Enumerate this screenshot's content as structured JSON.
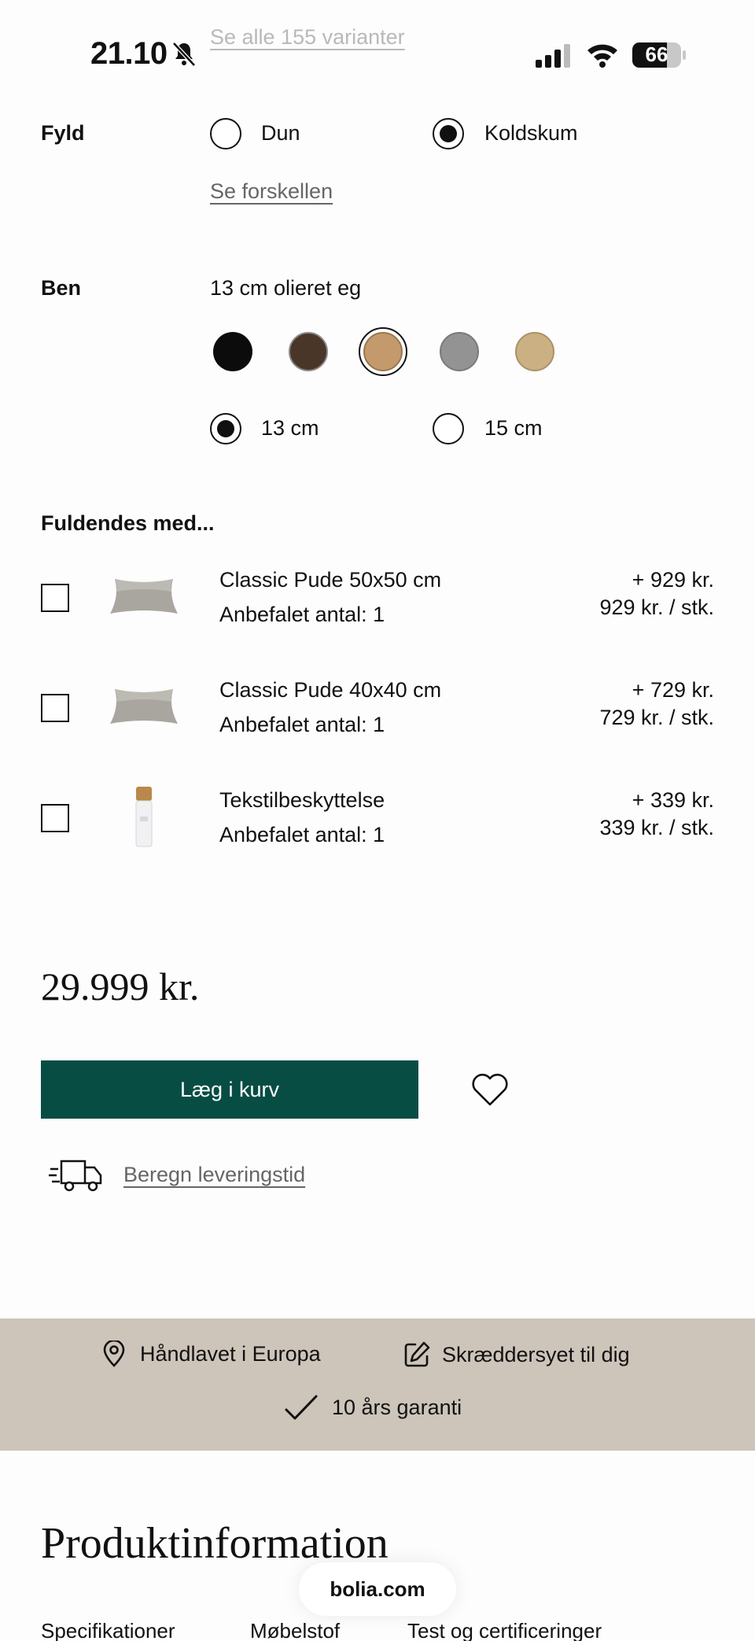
{
  "status_bar": {
    "time": "21.10",
    "battery": "66"
  },
  "variants_link": "Se alle 155 varianter",
  "fill": {
    "label": "Fyld",
    "options": [
      {
        "label": "Dun",
        "selected": false
      },
      {
        "label": "Koldskum",
        "selected": true
      }
    ],
    "compare_link": "Se forskellen"
  },
  "legs": {
    "label": "Ben",
    "selected_finish": "13 cm olieret eg",
    "swatch_colors": [
      "#0c0c0c",
      "#4a3629",
      "#c49a6c",
      "#939393",
      "#cbb083"
    ],
    "selected_swatch": 2,
    "heights": [
      {
        "label": "13 cm",
        "selected": true
      },
      {
        "label": "15 cm",
        "selected": false
      }
    ]
  },
  "addons": {
    "heading": "Fuldendes med...",
    "items": [
      {
        "name": "Classic Pude 50x50 cm",
        "recommended": "Anbefalet antal: 1",
        "price": "+ 929 kr.",
        "unit_price": "929 kr. / stk.",
        "checked": false
      },
      {
        "name": "Classic Pude 40x40 cm",
        "recommended": "Anbefalet antal: 1",
        "price": "+ 729 kr.",
        "unit_price": "729 kr. / stk.",
        "checked": false
      },
      {
        "name": "Tekstilbeskyttelse",
        "recommended": "Anbefalet antal: 1",
        "price": "+ 339 kr.",
        "unit_price": "339 kr. / stk.",
        "checked": false
      }
    ]
  },
  "price": "29.999 kr.",
  "cart_button": "Læg i kurv",
  "delivery_link": "Beregn leveringstid",
  "usp": {
    "handmade": "Håndlavet i Europa",
    "tailored": "Skræddersyet til dig",
    "warranty": "10 års garanti"
  },
  "product_info": {
    "title": "Produktinformation",
    "tabs": [
      "Specifikationer",
      "Møbelstof",
      "Test og certificeringer"
    ]
  },
  "browser": {
    "domain": "bolia.com"
  },
  "colors": {
    "accent": "#074d43",
    "band": "#cdc4ba"
  }
}
